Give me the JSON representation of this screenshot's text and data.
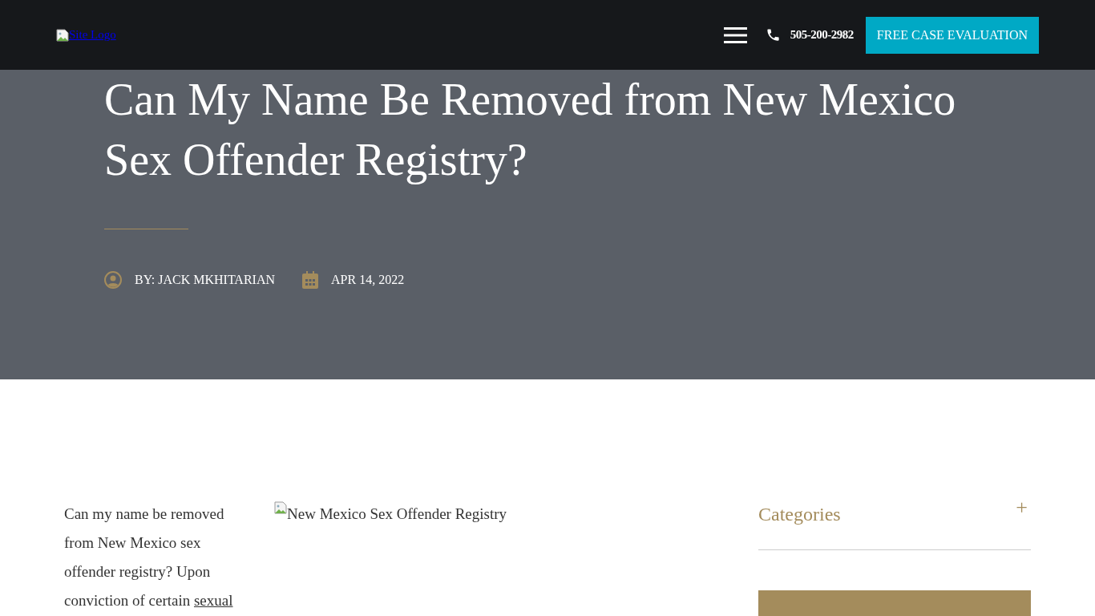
{
  "header": {
    "logo_alt": "Site Logo",
    "phone": "505-200-2982",
    "cta": "FREE CASE EVALUATION"
  },
  "hero": {
    "title": "Can My Name Be Removed from New Mexico Sex Offender Registry?",
    "author": "BY: JACK MKHITARIAN",
    "date": "APR 14, 2022"
  },
  "article": {
    "paragraph": "Can my name be removed from New Mexico sex offender registry? Upon conviction of certain",
    "link": "sexual",
    "image_alt": "New Mexico Sex Offender Registry"
  },
  "sidebar": {
    "heading": "Categories",
    "toggle": "+",
    "expanded": false
  }
}
